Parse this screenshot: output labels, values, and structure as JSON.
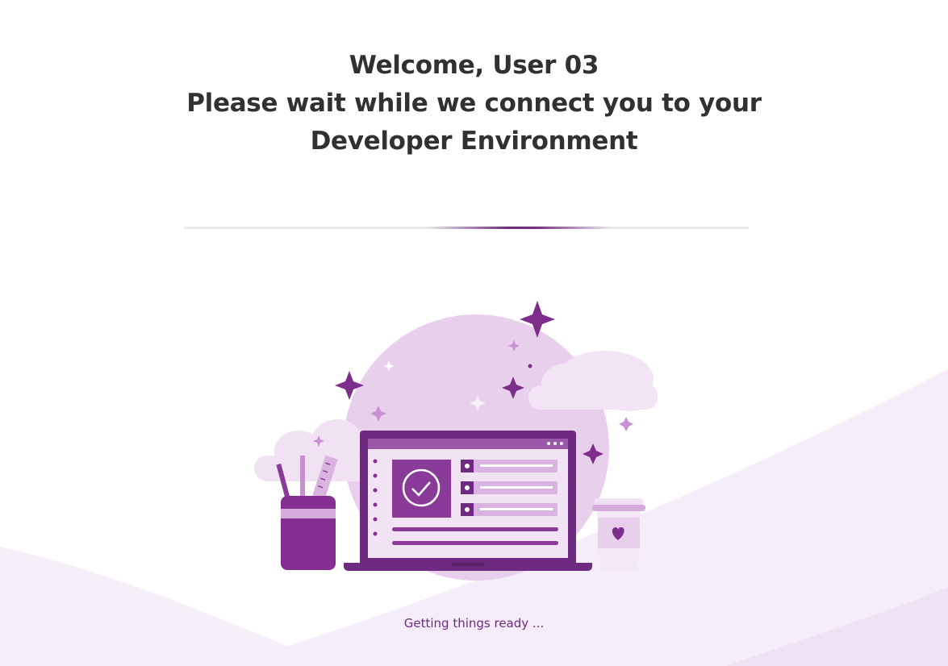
{
  "heading": {
    "line1": "Welcome, User 03",
    "line2": "Please wait while we connect you to your",
    "line3": "Developer Environment"
  },
  "status": {
    "text": "Getting things ready ..."
  },
  "colors": {
    "accent": "#7c2e8a",
    "accent_dark": "#5c1f6b",
    "lavender": "#e4c6e8",
    "pale_lavender": "#f5ecf8",
    "text_dark": "#323130"
  },
  "illustration": {
    "name": "laptop-checklist-illustration",
    "icons": [
      "sparkle-icon",
      "cloud-icon",
      "pencil-cup-icon",
      "laptop-icon",
      "checkmark-icon",
      "coffee-cup-icon",
      "heart-icon"
    ]
  }
}
